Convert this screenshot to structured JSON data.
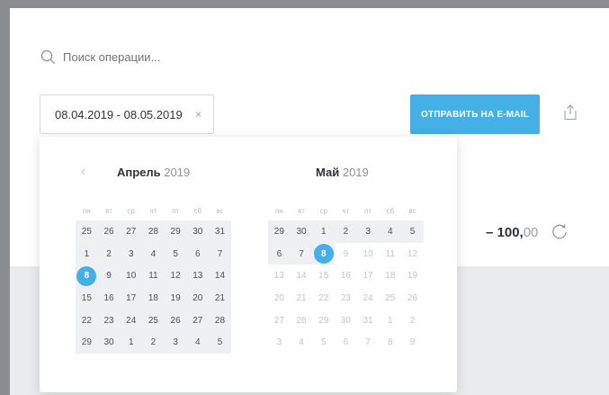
{
  "search": {
    "placeholder": "Поиск операции..."
  },
  "date_range": {
    "value": "08.04.2019 - 08.05.2019",
    "clear_symbol": "×"
  },
  "email_button": {
    "label": "ОТПРАВИТЬ НА E-MAIL"
  },
  "transaction": {
    "amount_main": "– 100,",
    "amount_cents": "00"
  },
  "calendar": {
    "prev_symbol": "‹",
    "weekdays": [
      "пн",
      "вт",
      "ср",
      "чт",
      "пт",
      "сб",
      "вс"
    ],
    "months": [
      {
        "name": "Апрель",
        "year": "2019",
        "weeks": [
          [
            "25",
            "26",
            "27",
            "28",
            "29",
            "30",
            "31"
          ],
          [
            "1",
            "2",
            "3",
            "4",
            "5",
            "6",
            "7"
          ],
          [
            "8",
            "9",
            "10",
            "11",
            "12",
            "13",
            "14"
          ],
          [
            "15",
            "16",
            "17",
            "18",
            "19",
            "20",
            "21"
          ],
          [
            "22",
            "23",
            "24",
            "25",
            "26",
            "27",
            "28"
          ],
          [
            "29",
            "30",
            "1",
            "2",
            "3",
            "4",
            "5"
          ]
        ],
        "selected": "8"
      },
      {
        "name": "Май",
        "year": "2019",
        "weeks": [
          [
            "29",
            "30",
            "1",
            "2",
            "3",
            "4",
            "5"
          ],
          [
            "6",
            "7",
            "8",
            "9",
            "10",
            "11",
            "12"
          ],
          [
            "13",
            "14",
            "15",
            "16",
            "17",
            "18",
            "19"
          ],
          [
            "20",
            "21",
            "22",
            "23",
            "24",
            "25",
            "26"
          ],
          [
            "27",
            "28",
            "29",
            "30",
            "31",
            "1",
            "2"
          ],
          [
            "3",
            "4",
            "5",
            "6",
            "7",
            "8",
            "9"
          ]
        ],
        "selected": "8"
      }
    ]
  },
  "colors": {
    "accent": "#45b0e6",
    "range_bg": "#eef0f3"
  }
}
